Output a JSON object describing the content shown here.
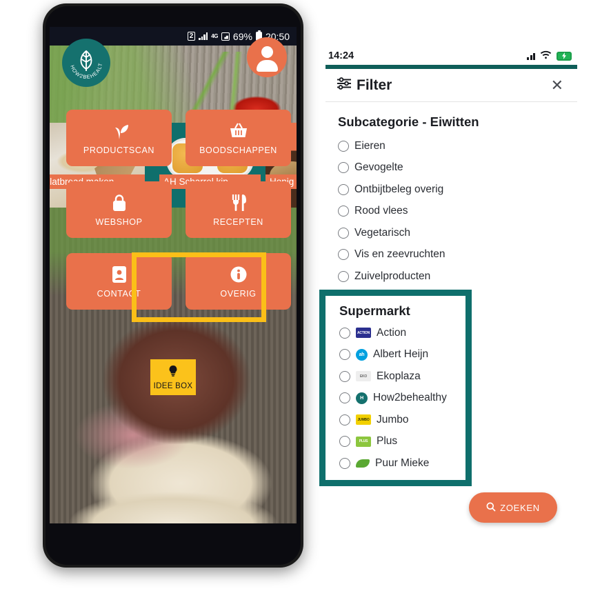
{
  "phone": {
    "status_bar": {
      "notification_count": "2",
      "network_type": "4G",
      "battery_percent": "69%",
      "time": "20:50"
    },
    "header": {
      "logo_text": "HOW2BEHEALTHY",
      "avatar_icon": "user-avatar-icon"
    },
    "carousel": [
      {
        "caption": "Flatbread maken...",
        "image": "flatbread-photo"
      },
      {
        "caption": "AH Scharrel kip...",
        "image": "chicken-nuggets-package-photo"
      },
      {
        "caption": "Honig",
        "image": "honig-product-photo"
      }
    ],
    "actions": [
      {
        "label": "PRODUCTSCAN",
        "icon": "sprout-icon"
      },
      {
        "label": "BOODSCHAPPEN",
        "icon": "shopping-basket-icon"
      },
      {
        "label": "WEBSHOP",
        "icon": "shopping-bag-icon"
      },
      {
        "label": "RECEPTEN",
        "icon": "fork-knife-icon"
      },
      {
        "label": "CONTACT",
        "icon": "contact-card-icon"
      },
      {
        "label": "OVERIG",
        "icon": "info-icon"
      }
    ],
    "idee_box": {
      "label": "IDEE BOX",
      "icon": "lightbulb-icon"
    },
    "highlight_color": "#FBBF18"
  },
  "filter": {
    "status_bar": {
      "time": "14:24"
    },
    "header": {
      "title": "Filter",
      "icon": "filter-sliders-icon",
      "close_icon": "close-icon"
    },
    "subcategorie": {
      "title": "Subcategorie - Eiwitten",
      "options": [
        {
          "label": "Eieren",
          "selected": false
        },
        {
          "label": "Gevogelte",
          "selected": false
        },
        {
          "label": "Ontbijtbeleg overig",
          "selected": false
        },
        {
          "label": "Rood vlees",
          "selected": false
        },
        {
          "label": "Vegetarisch",
          "selected": false
        },
        {
          "label": "Vis en zeevruchten",
          "selected": false
        },
        {
          "label": "Zuivelproducten",
          "selected": false
        }
      ]
    },
    "supermarkt": {
      "title": "Supermarkt",
      "highlight_color": "#0F6F6C",
      "options": [
        {
          "label": "Action",
          "logo": "action-logo",
          "logo_color": "#2b2f8f",
          "logo_text": "ACTION"
        },
        {
          "label": "Albert Heijn",
          "logo": "albert-heijn-logo",
          "logo_color": "#00a0df",
          "logo_text": "ah"
        },
        {
          "label": "Ekoplaza",
          "logo": "ekoplaza-logo",
          "logo_color": "#e9e9e9",
          "logo_text": "EKO"
        },
        {
          "label": "How2behealthy",
          "logo": "how2behealthy-logo",
          "logo_color": "#15716E",
          "logo_text": "H"
        },
        {
          "label": "Jumbo",
          "logo": "jumbo-logo",
          "logo_color": "#f2d000",
          "logo_text": "JUMBO"
        },
        {
          "label": "Plus",
          "logo": "plus-logo",
          "logo_color": "#8cc63e",
          "logo_text": "PLUS"
        },
        {
          "label": "Puur Mieke",
          "logo": "puur-mieke-logo",
          "logo_color": "#5aa832",
          "logo_text": ""
        }
      ]
    },
    "search_button": {
      "label": "ZOEKEN",
      "icon": "search-icon"
    }
  },
  "theme": {
    "teal": "#0F6F6C",
    "teal_dark": "#0F5E59",
    "orange": "#E9714B",
    "yellow": "#FBC21B"
  }
}
